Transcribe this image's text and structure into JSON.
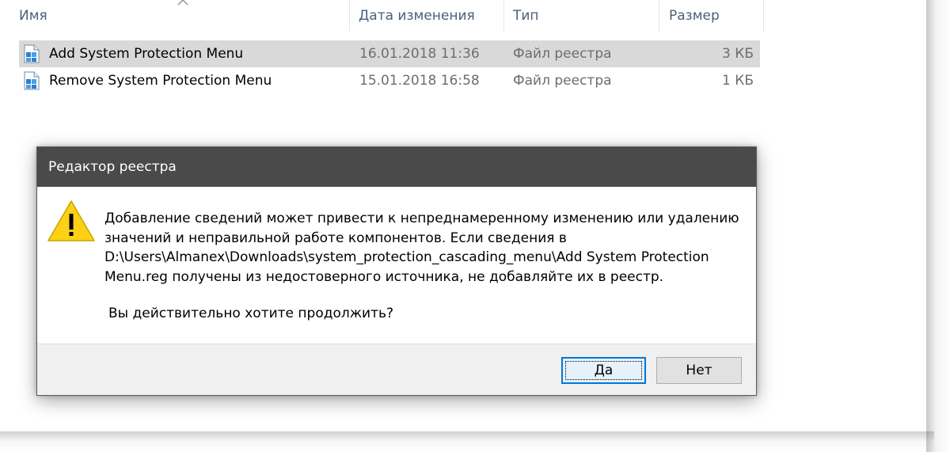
{
  "explorer": {
    "columns": {
      "name": "Имя",
      "date": "Дата изменения",
      "type": "Тип",
      "size": "Размер"
    },
    "files": [
      {
        "name": "Add System Protection Menu",
        "date": "16.01.2018 11:36",
        "type": "Файл реестра",
        "size": "3 КБ",
        "selected": true,
        "icon": "registry-file-icon"
      },
      {
        "name": "Remove System Protection Menu",
        "date": "15.01.2018 16:58",
        "type": "Файл реестра",
        "size": "1 КБ",
        "selected": false,
        "icon": "registry-file-icon"
      }
    ]
  },
  "dialog": {
    "title": "Редактор реестра",
    "icon": "warning-icon",
    "message_lines": [
      "Добавление сведений может привести к непреднамеренному изменению или удалению",
      "значений и неправильной работе компонентов. Если сведения в",
      "D:\\Users\\Almanex\\Downloads\\system_protection_cascading_menu\\Add System Protection",
      "Menu.reg получены из недостоверного источника, не добавляйте их в реестр."
    ],
    "question": "Вы действительно хотите продолжить?",
    "buttons": {
      "yes": "Да",
      "no": "Нет"
    }
  },
  "colors": {
    "titlebar": "#4a4a4a",
    "selection": "#d9d9d9",
    "accent": "#0078d7",
    "warning": "#fcd116"
  }
}
